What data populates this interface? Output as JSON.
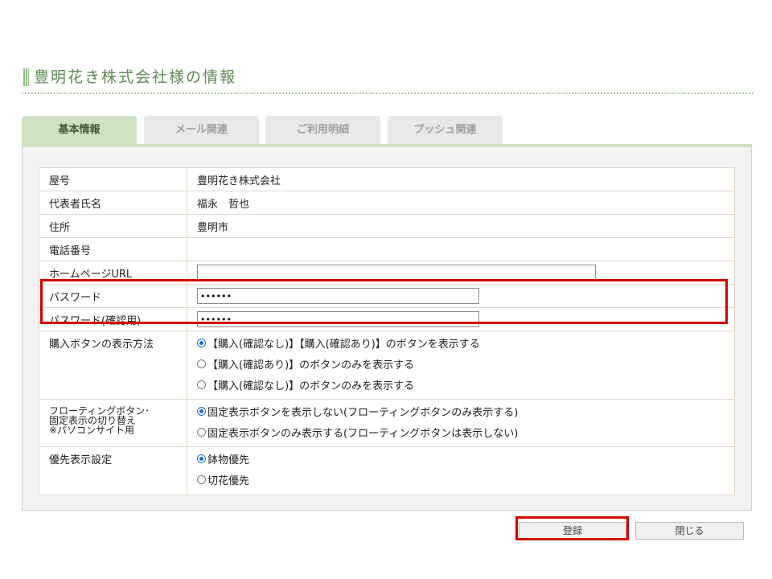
{
  "page": {
    "title": "豊明花き株式会社様の情報"
  },
  "tabs": [
    {
      "label": "基本情報",
      "active": true
    },
    {
      "label": "メール関連",
      "active": false
    },
    {
      "label": "ご利用明細",
      "active": false
    },
    {
      "label": "プッシュ関連",
      "active": false
    }
  ],
  "form": {
    "shop_name": {
      "label": "屋号",
      "value": "豊明花き株式会社"
    },
    "representative": {
      "label": "代表者氏名",
      "value": "福永　哲也"
    },
    "address": {
      "label": "住所",
      "value": "豊明市"
    },
    "phone": {
      "label": "電話番号",
      "value": ""
    },
    "homepage": {
      "label": "ホームページURL",
      "value": ""
    },
    "password": {
      "label": "パスワード",
      "value": "••••••"
    },
    "password_confirm": {
      "label": "パスワード(確認用)",
      "value": "••••••"
    },
    "purchase_button_display": {
      "label": "購入ボタンの表示方法",
      "options": [
        {
          "label": "【購入(確認なし)】【購入(確認あり)】のボタンを表示する",
          "selected": true
        },
        {
          "label": "【購入(確認あり)】のボタンのみを表示する",
          "selected": false
        },
        {
          "label": "【購入(確認なし)】のボタンのみを表示する",
          "selected": false
        }
      ]
    },
    "floating_button": {
      "label_line1": "フローティングボタン･",
      "label_line2": "固定表示の切り替え",
      "label_line3": "※パソコンサイト用",
      "options": [
        {
          "label": "固定表示ボタンを表示しない(フローティングボタンのみ表示する)",
          "selected": true
        },
        {
          "label": "固定表示ボタンのみ表示する(フローティングボタンは表示しない)",
          "selected": false
        }
      ]
    },
    "priority": {
      "label": "優先表示設定",
      "options": [
        {
          "label": "鉢物優先",
          "selected": true
        },
        {
          "label": "切花優先",
          "selected": false
        }
      ]
    }
  },
  "buttons": {
    "register": "登録",
    "close": "閉じる"
  },
  "colors": {
    "title_green": "#5a8a4e",
    "tab_active": "#cfe2c4",
    "highlight_red": "#d40000",
    "radio_blue": "#1a6fd1"
  }
}
